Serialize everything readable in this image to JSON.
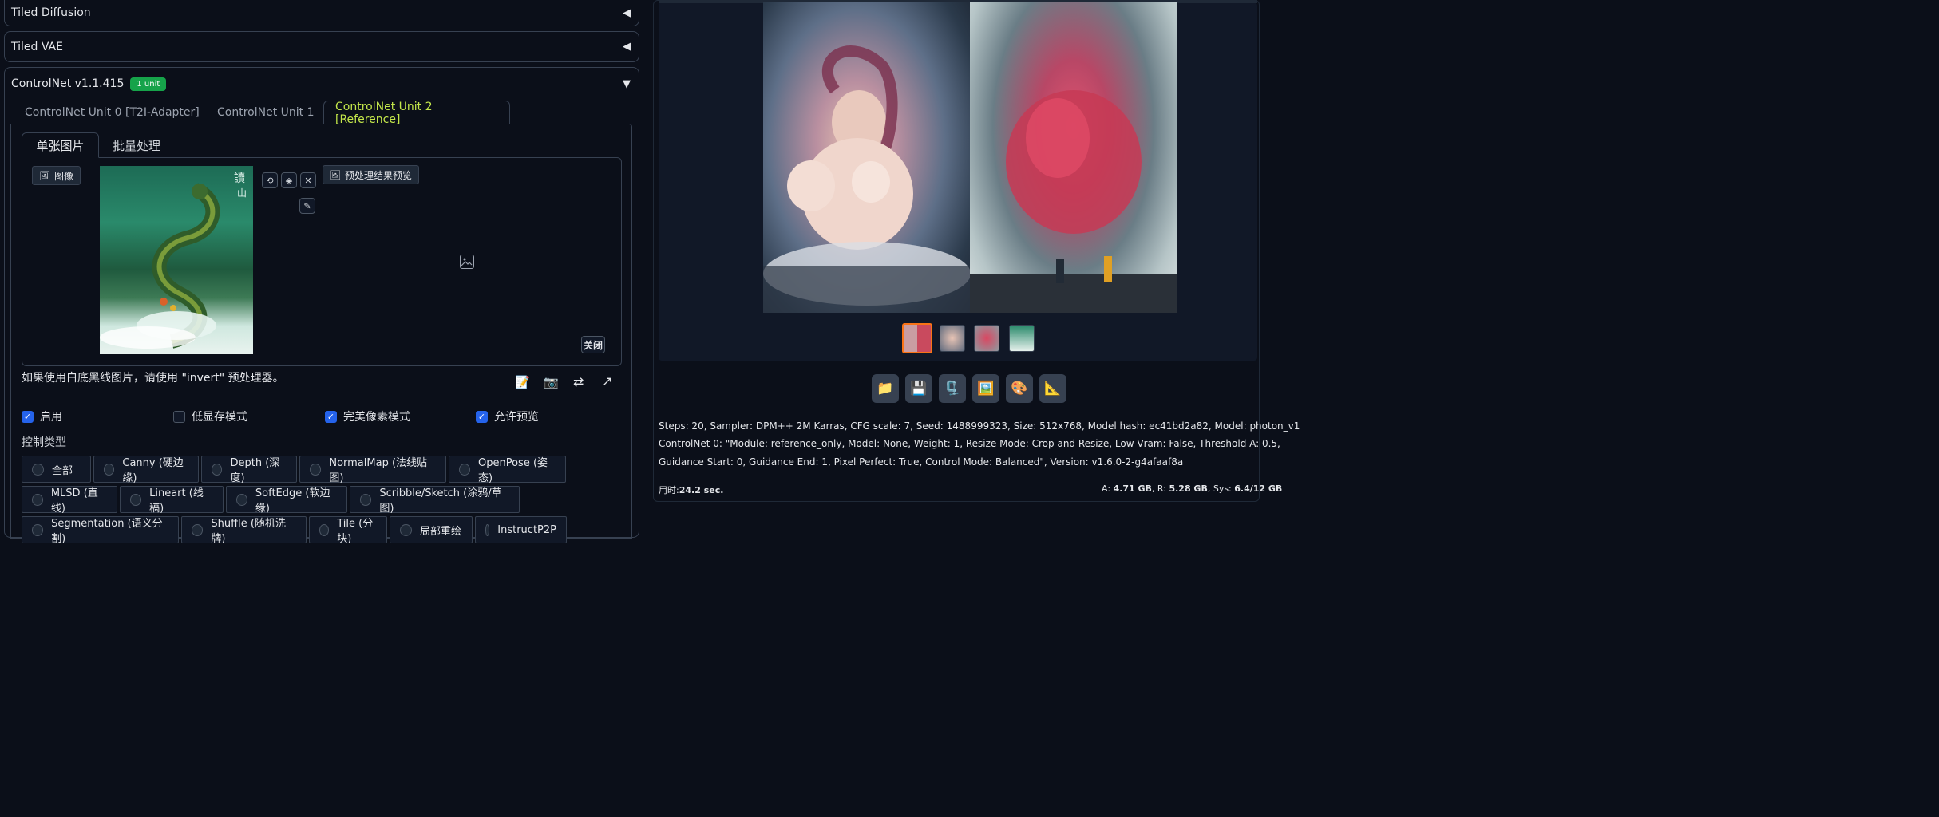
{
  "accordions": {
    "tiled_diffusion": "Tiled Diffusion",
    "tiled_vae": "Tiled VAE",
    "controlnet_title": "ControlNet v1.1.415",
    "controlnet_badge": "1 unit",
    "collapsed_arrow": "◀",
    "expanded_arrow": "▼"
  },
  "unit_tabs": [
    "ControlNet Unit 0 [T2I-Adapter]",
    "ControlNet Unit 1",
    "ControlNet Unit 2 [Reference]"
  ],
  "sub_tabs": [
    "单张图片",
    "批量处理"
  ],
  "image_label": "图像",
  "preview_label": "预处理结果预览",
  "close_label": "关闭",
  "hint": "如果使用白底黑线图片，请使用 \"invert\" 预处理器。",
  "checkboxes": [
    {
      "label": "启用",
      "checked": true
    },
    {
      "label": "低显存模式",
      "checked": false
    },
    {
      "label": "完美像素模式",
      "checked": true
    },
    {
      "label": "允许预览",
      "checked": true
    }
  ],
  "control_type_label": "控制类型",
  "control_types_row1": [
    "全部",
    "Canny (硬边缘)",
    "Depth (深度)",
    "NormalMap (法线贴图)",
    "OpenPose (姿态)"
  ],
  "control_types_row2": [
    "MLSD (直线)",
    "Lineart (线稿)",
    "SoftEdge (软边缘)",
    "Scribble/Sketch (涂鸦/草图)"
  ],
  "control_types_row3": [
    "Segmentation (语义分割)",
    "Shuffle (随机洗牌)",
    "Tile (分块)",
    "局部重绘",
    "InstructP2P"
  ],
  "output": {
    "info_line1": "Steps: 20, Sampler: DPM++ 2M Karras, CFG scale: 7, Seed: 1488999323, Size: 512x768, Model hash: ec41bd2a82, Model: photon_v1",
    "info_line2": "ControlNet 0: \"Module: reference_only, Model: None, Weight: 1, Resize Mode: Crop and Resize, Low Vram: False, Threshold A: 0.5,",
    "info_line3": "Guidance Start: 0, Guidance End: 1, Pixel Perfect: True, Control Mode: Balanced\", Version: v1.6.0-2-g4afaaf8a",
    "time_label": "用时:",
    "time_value": "24.2 sec.",
    "mem_a_label": "A: ",
    "mem_a": "4.71 GB",
    "mem_r_label": ", R: ",
    "mem_r": "5.28 GB",
    "mem_sys_label": ", Sys: ",
    "mem_sys": "6.4/12 GB"
  },
  "tools": [
    "📁",
    "💾",
    "🗜️",
    "🖼️",
    "🎨",
    "📐"
  ],
  "hint_icons": [
    "📝",
    "📷",
    "⇄",
    "↗"
  ]
}
